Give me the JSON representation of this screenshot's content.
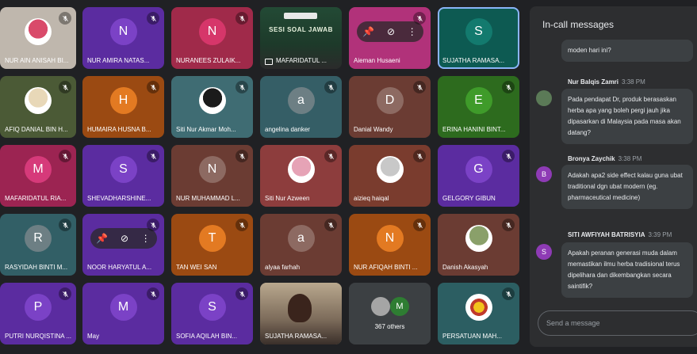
{
  "panel": {
    "title": "In-call messages",
    "send_placeholder": "Send a message",
    "messages": [
      {
        "sender": "",
        "time": "",
        "text": "moden hari ini?",
        "avatar_letter": "",
        "avatar_color": ""
      },
      {
        "sender": "Nur Balqis Zamri",
        "time": "3:38 PM",
        "text": "Pada pendapat Dr, produk berasaskan herba apa yang boleh pergi jauh jika dipasarkan di Malaysia pada masa akan datang?",
        "avatar_letter": "",
        "avatar_color": "#5b7a57"
      },
      {
        "sender": "Bronya Zaychik",
        "time": "3:38 PM",
        "text": "Adakah apa2 side effect kalau guna ubat traditional dgn ubat modern (eg. pharmaceutical medicine)",
        "avatar_letter": "B",
        "avatar_color": "#8e3bb5"
      },
      {
        "sender": "SITI AWFIYAH BATRISYIA",
        "time": "3:39 PM",
        "text": "Apakah peranan generasi muda dalam memastikan ilmu herba tradisional terus dipelihara dan dikembangkan secara saintifik?",
        "avatar_letter": "S",
        "avatar_color": "#8e3bb5"
      }
    ]
  },
  "tiles": [
    {
      "name": "NUR AIN ANISAH BI...",
      "letter": "",
      "type": "photo",
      "bg": "#bfb7ad",
      "muted": true,
      "photo_color": "#d94a6a"
    },
    {
      "name": "NUR AMIRA NATAS...",
      "letter": "N",
      "type": "avatar",
      "bg": "#5b2ca0",
      "avatar": "#7b42c6",
      "muted": true
    },
    {
      "name": "NURANEES ZULAIK...",
      "letter": "N",
      "type": "avatar",
      "bg": "#a02a4a",
      "avatar": "#d6366a",
      "muted": true
    },
    {
      "name": "MAFARIDATUL ...",
      "letter": "",
      "type": "presentation",
      "bg": "#1f3d2c",
      "muted": false,
      "slide_title": "SESI SOAL JAWAB"
    },
    {
      "name": "Aieman Husaeni",
      "letter": "",
      "type": "pinned",
      "bg": "#b1327a",
      "muted": true
    },
    {
      "name": "SUJATHA RAMASA...",
      "letter": "S",
      "type": "avatar",
      "bg": "#0d5a52",
      "avatar": "#137a6e",
      "muted": false,
      "active": true
    },
    {
      "name": "AFIQ DANIAL BIN H...",
      "letter": "",
      "type": "photo",
      "bg": "#4b5a36",
      "muted": true,
      "photo_color": "#e8d8b8"
    },
    {
      "name": "HUMAIRA HUSNA B...",
      "letter": "H",
      "type": "avatar",
      "bg": "#9b4a12",
      "avatar": "#e37a22",
      "muted": true
    },
    {
      "name": "Siti Nur Akmar Moh...",
      "letter": "",
      "type": "photo",
      "bg": "#3f6c73",
      "muted": true,
      "photo_color": "#1b1b1b"
    },
    {
      "name": "angelina danker",
      "letter": "a",
      "type": "avatar",
      "bg": "#355e66",
      "avatar": "#6d7f84",
      "muted": true
    },
    {
      "name": "Danial Wandy",
      "letter": "D",
      "type": "avatar",
      "bg": "#6b3c33",
      "avatar": "#8d6a62",
      "muted": true
    },
    {
      "name": "ERINA HANINI BINT...",
      "letter": "E",
      "type": "avatar",
      "bg": "#2d6b1e",
      "avatar": "#3f9b2a",
      "muted": true
    },
    {
      "name": "MAFARIDATUL RIA...",
      "letter": "M",
      "type": "avatar",
      "bg": "#9c2452",
      "avatar": "#d63a7a",
      "muted": true
    },
    {
      "name": "SHEVADHARSHINE...",
      "letter": "S",
      "type": "avatar",
      "bg": "#5b2ca0",
      "avatar": "#7b42c6",
      "muted": true
    },
    {
      "name": "NUR MUHAMMAD L...",
      "letter": "N",
      "type": "avatar",
      "bg": "#6b3c33",
      "avatar": "#8d6a62",
      "muted": true
    },
    {
      "name": "Siti Nur Azween",
      "letter": "",
      "type": "photo",
      "bg": "#8d3d3d",
      "muted": true,
      "photo_color": "#e6a3b6"
    },
    {
      "name": "aizieq haiqal",
      "letter": "",
      "type": "photo",
      "bg": "#7a3c2e",
      "muted": true,
      "photo_color": "#c8c8c8"
    },
    {
      "name": "GELGORY GIBUN",
      "letter": "G",
      "type": "avatar",
      "bg": "#5b2ca0",
      "avatar": "#7b42c6",
      "muted": true
    },
    {
      "name": "RASYIDAH BINTI M...",
      "letter": "R",
      "type": "avatar",
      "bg": "#325f66",
      "avatar": "#6d7f84",
      "muted": true
    },
    {
      "name": "NOOR HARYATUL A...",
      "letter": "",
      "type": "pinned",
      "bg": "#5b2ca0",
      "muted": true
    },
    {
      "name": "TAN WEI SAN",
      "letter": "T",
      "type": "avatar",
      "bg": "#9b4a12",
      "avatar": "#e37a22",
      "muted": true
    },
    {
      "name": "alyaa farhah",
      "letter": "a",
      "type": "avatar",
      "bg": "#6b3c33",
      "avatar": "#8d6a62",
      "muted": true
    },
    {
      "name": "NUR AFIQAH BINTI ...",
      "letter": "N",
      "type": "avatar",
      "bg": "#9b4a12",
      "avatar": "#e37a22",
      "muted": true
    },
    {
      "name": "Danish Akasyah",
      "letter": "",
      "type": "photo",
      "bg": "#6b3c33",
      "muted": true,
      "photo_color": "#8aa06a"
    },
    {
      "name": "PUTRI NURQISTINA ...",
      "letter": "P",
      "type": "avatar",
      "bg": "#5b2ca0",
      "avatar": "#7b42c6",
      "muted": true
    },
    {
      "name": "May",
      "letter": "M",
      "type": "avatar",
      "bg": "#5b2ca0",
      "avatar": "#7b42c6",
      "muted": true
    },
    {
      "name": "SOFIA AQILAH BIN...",
      "letter": "S",
      "type": "avatar",
      "bg": "#5b2ca0",
      "avatar": "#7b42c6",
      "muted": true
    },
    {
      "name": "SUJATHA RAMASA...",
      "letter": "",
      "type": "video",
      "bg": "#8c7a62",
      "muted": false
    },
    {
      "name": "367 others",
      "letter": "M",
      "type": "others",
      "bg": "#3c4043",
      "muted": false
    },
    {
      "name": "PERSATUAN MAH...",
      "letter": "",
      "type": "logo",
      "bg": "#2c5e62",
      "muted": true
    }
  ]
}
